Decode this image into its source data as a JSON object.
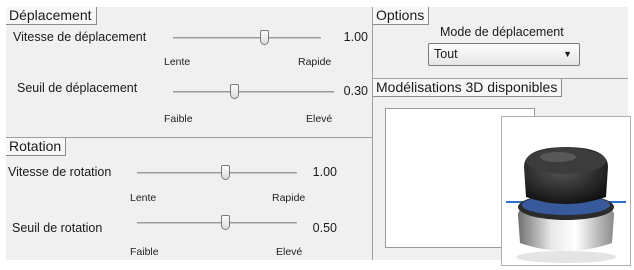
{
  "displacement": {
    "title": "Déplacement",
    "speed": {
      "label": "Vitesse de déplacement",
      "value": "1.00",
      "min_label": "Lente",
      "max_label": "Rapide",
      "level": 0.62
    },
    "threshold": {
      "label": "Seuil de déplacement",
      "value": "0.30",
      "min_label": "Faible",
      "max_label": "Elevé",
      "level": 0.38
    }
  },
  "rotation": {
    "title": "Rotation",
    "speed": {
      "label": "Vitesse de rotation",
      "value": "1.00",
      "min_label": "Lente",
      "max_label": "Rapide",
      "level": 0.55
    },
    "threshold": {
      "label": "Seuil de rotation",
      "value": "0.50",
      "min_label": "Faible",
      "max_label": "Elevé",
      "level": 0.55
    }
  },
  "options": {
    "title": "Options",
    "mode_label": "Mode de déplacement",
    "mode_value": "Tout"
  },
  "models": {
    "title": "Modélisations 3D disponibles"
  },
  "icons": {
    "dropdown": "chevron-down-icon",
    "device": "3d-mouse-device-image"
  }
}
